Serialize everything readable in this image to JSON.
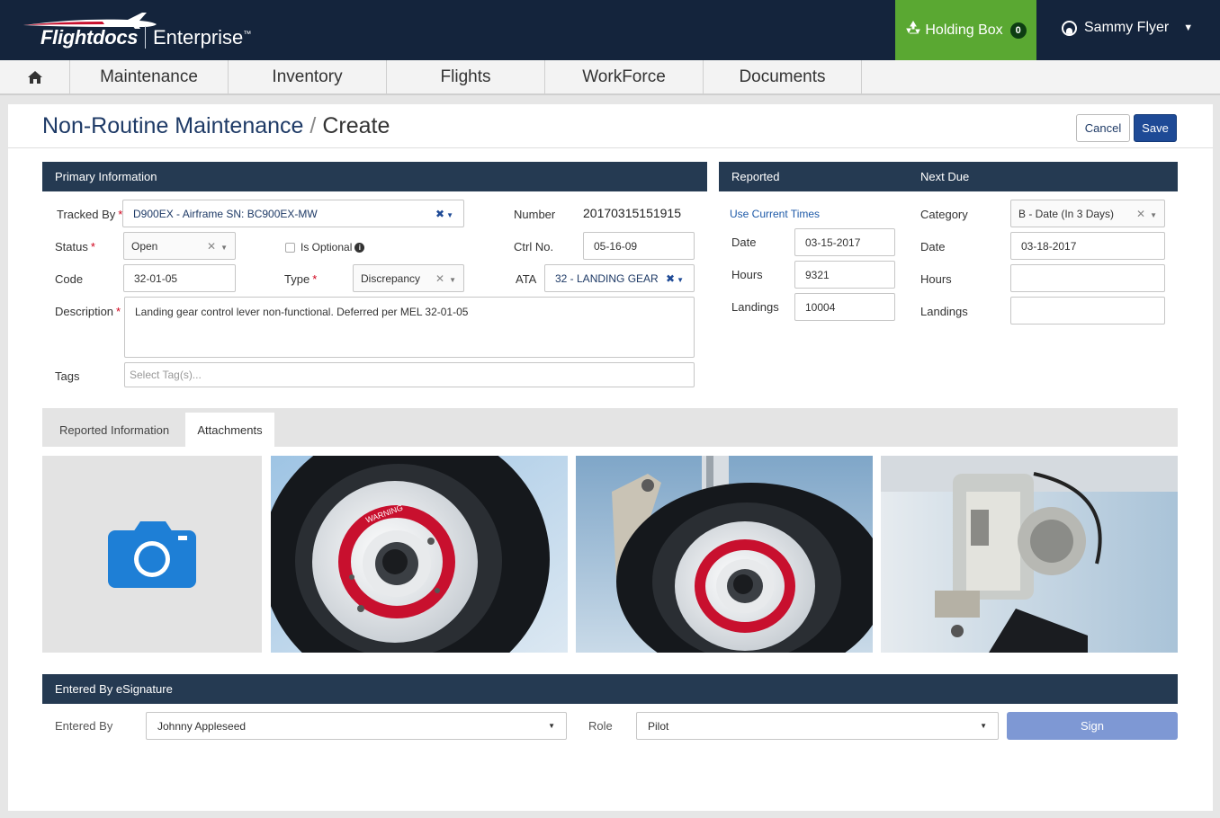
{
  "header": {
    "brand": "Flightdocs",
    "product": "Enterprise",
    "trademark": "™",
    "holding_box_label": "Holding Box",
    "holding_box_count": "0",
    "user_name": "Sammy Flyer"
  },
  "nav": {
    "items": [
      {
        "label": "Maintenance"
      },
      {
        "label": "Inventory"
      },
      {
        "label": "Flights"
      },
      {
        "label": "WorkForce"
      },
      {
        "label": "Documents"
      }
    ]
  },
  "page": {
    "title": "Non-Routine Maintenance",
    "separator": "/",
    "subtitle": "Create",
    "cancel_label": "Cancel",
    "save_label": "Save"
  },
  "primary": {
    "heading": "Primary Information",
    "tracked_by_label": "Tracked By",
    "tracked_by_value": "D900EX - Airframe SN: BC900EX-MW",
    "status_label": "Status",
    "status_value": "Open",
    "is_optional_label": "Is Optional",
    "is_optional_checked": false,
    "code_label": "Code",
    "code_value": "32-01-05",
    "type_label": "Type",
    "type_value": "Discrepancy",
    "number_label": "Number",
    "number_value": "20170315151915",
    "ctrl_no_label": "Ctrl No.",
    "ctrl_no_value": "05-16-09",
    "ata_label": "ATA",
    "ata_value": "32 - LANDING GEAR",
    "description_label": "Description",
    "description_value": "Landing gear control lever non-functional.  Deferred per MEL 32-01-05",
    "tags_label": "Tags",
    "tags_placeholder": "Select Tag(s)..."
  },
  "reported": {
    "heading": "Reported",
    "use_current_times": "Use Current Times",
    "date_label": "Date",
    "date_value": "03-15-2017",
    "hours_label": "Hours",
    "hours_value": "9321",
    "landings_label": "Landings",
    "landings_value": "10004"
  },
  "next_due": {
    "heading": "Next Due",
    "category_label": "Category",
    "category_value": "B - Date (In 3 Days)",
    "date_label": "Date",
    "date_value": "03-18-2017",
    "hours_label": "Hours",
    "hours_value": "",
    "landings_label": "Landings",
    "landings_value": ""
  },
  "tabs": {
    "reported_info": "Reported Information",
    "attachments": "Attachments",
    "active": "Attachments"
  },
  "attachments": {
    "warning_text": "WARNING"
  },
  "esignature": {
    "heading": "Entered By eSignature",
    "entered_by_label": "Entered By",
    "entered_by_value": "Johnny Appleseed",
    "role_label": "Role",
    "role_value": "Pilot",
    "sign_label": "Sign"
  },
  "colors": {
    "header_bg": "#14243c",
    "holding_box_bg": "#5aa832",
    "section_header_bg": "#253a52",
    "save_button": "#1e4a96",
    "sign_button": "#7e98d4",
    "camera_icon": "#1e7fd6",
    "required": "#d0021b"
  }
}
